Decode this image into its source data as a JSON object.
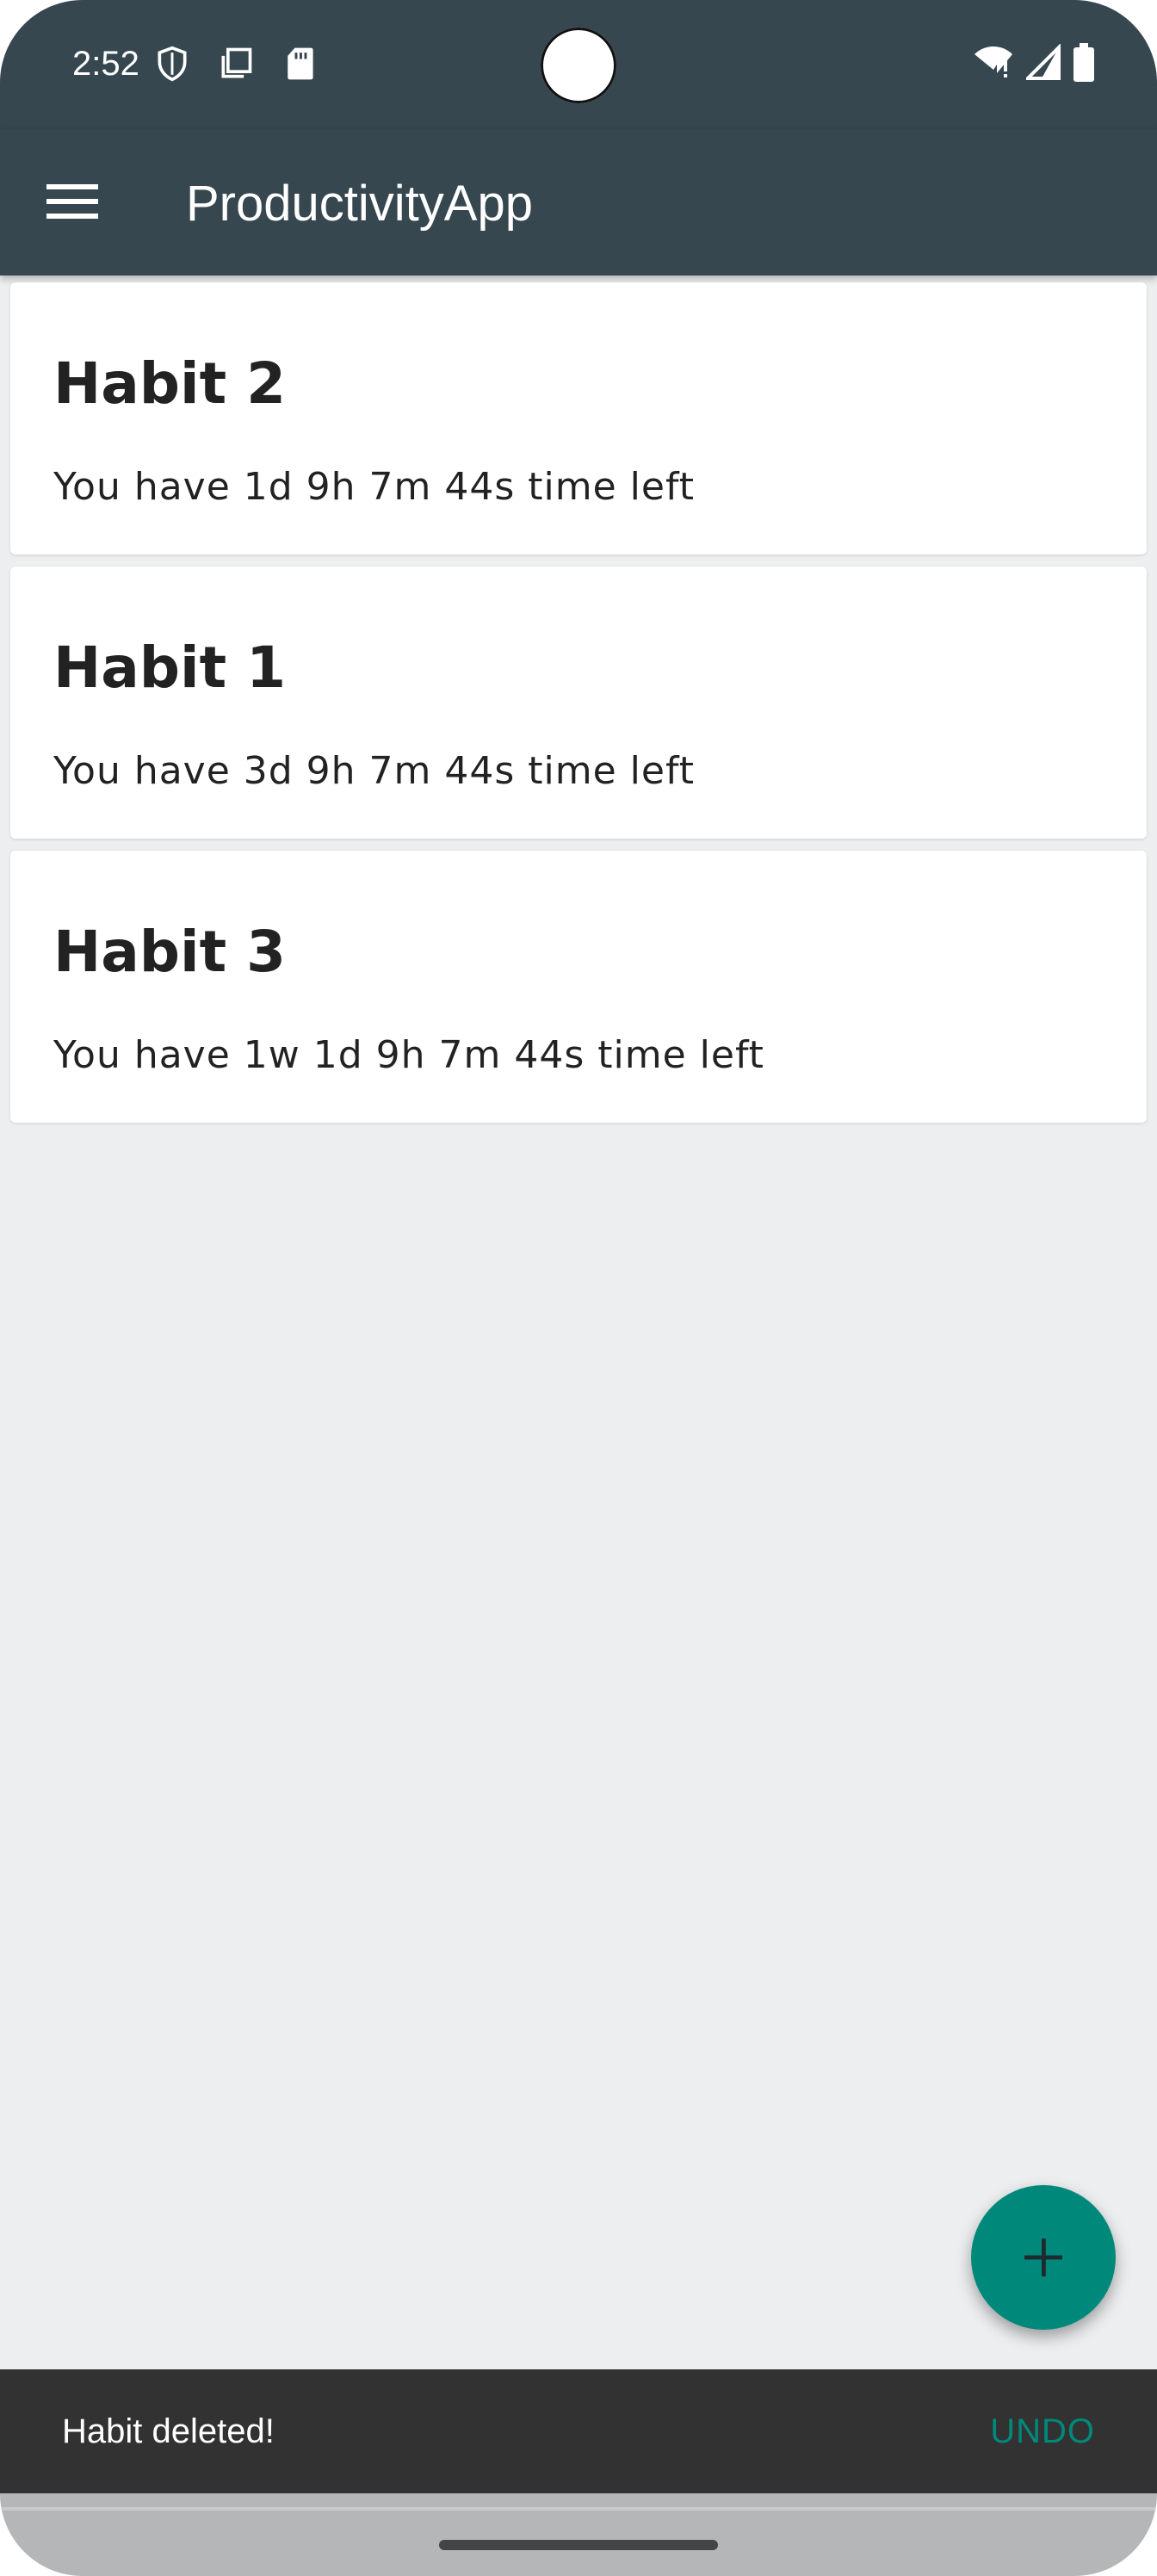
{
  "status_bar": {
    "time": "2:52",
    "left_icons": [
      "shield-icon",
      "screenshot-icon",
      "sd-card-icon"
    ],
    "right_icons": [
      "wifi-icon",
      "signal-icon",
      "battery-icon"
    ]
  },
  "app_bar": {
    "title": "ProductivityApp",
    "menu_icon": "hamburger-menu-icon"
  },
  "habits": [
    {
      "name": "Habit 2",
      "time_left": "You have 1d 9h 7m 44s time left"
    },
    {
      "name": "Habit 1",
      "time_left": "You have 3d 9h 7m 44s time left"
    },
    {
      "name": "Habit 3",
      "time_left": "You have 1w 1d 9h 7m 44s time left"
    }
  ],
  "fab": {
    "icon": "plus-icon"
  },
  "snackbar": {
    "message": "Habit deleted!",
    "action": "UNDO"
  },
  "colors": {
    "app_bar": "#37474f",
    "background": "#edeef0",
    "accent": "#00897b",
    "snackbar": "#323232"
  }
}
